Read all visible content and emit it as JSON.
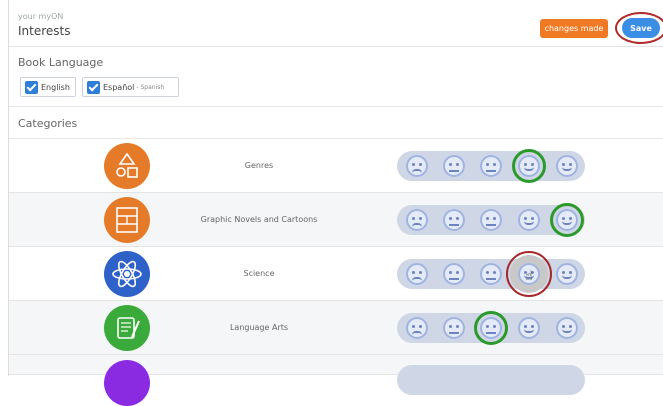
{
  "header": {
    "subtitle": "your myON",
    "title": "Interests",
    "changes_label": "changes made",
    "save_label": "Save"
  },
  "book_language": {
    "label": "Book Language",
    "options": [
      {
        "label": "English",
        "note": "",
        "checked": true
      },
      {
        "label": "Español",
        "note": "- Spanish",
        "checked": true
      }
    ]
  },
  "categories": {
    "label": "Categories",
    "rating_scale": [
      "sad",
      "neutral",
      "slightly-happy",
      "happy",
      "very-happy"
    ],
    "items": [
      {
        "name": "Genres",
        "icon": "genres-icon",
        "color": "#e57b28",
        "rating": 4
      },
      {
        "name": "Graphic Novels and Cartoons",
        "icon": "graphic-novels-icon",
        "color": "#e57b28",
        "rating": 5
      },
      {
        "name": "Science",
        "icon": "atom-icon",
        "color": "#2f62c9",
        "rating": 4,
        "hovered": true
      },
      {
        "name": "Language Arts",
        "icon": "language-arts-icon",
        "color": "#3aaa3a",
        "rating": 3
      }
    ]
  },
  "colors": {
    "accent": "#3a8ee6",
    "changes": "#f07a24",
    "selected": "#2a9a2a",
    "highlight": "#b22b2b"
  }
}
